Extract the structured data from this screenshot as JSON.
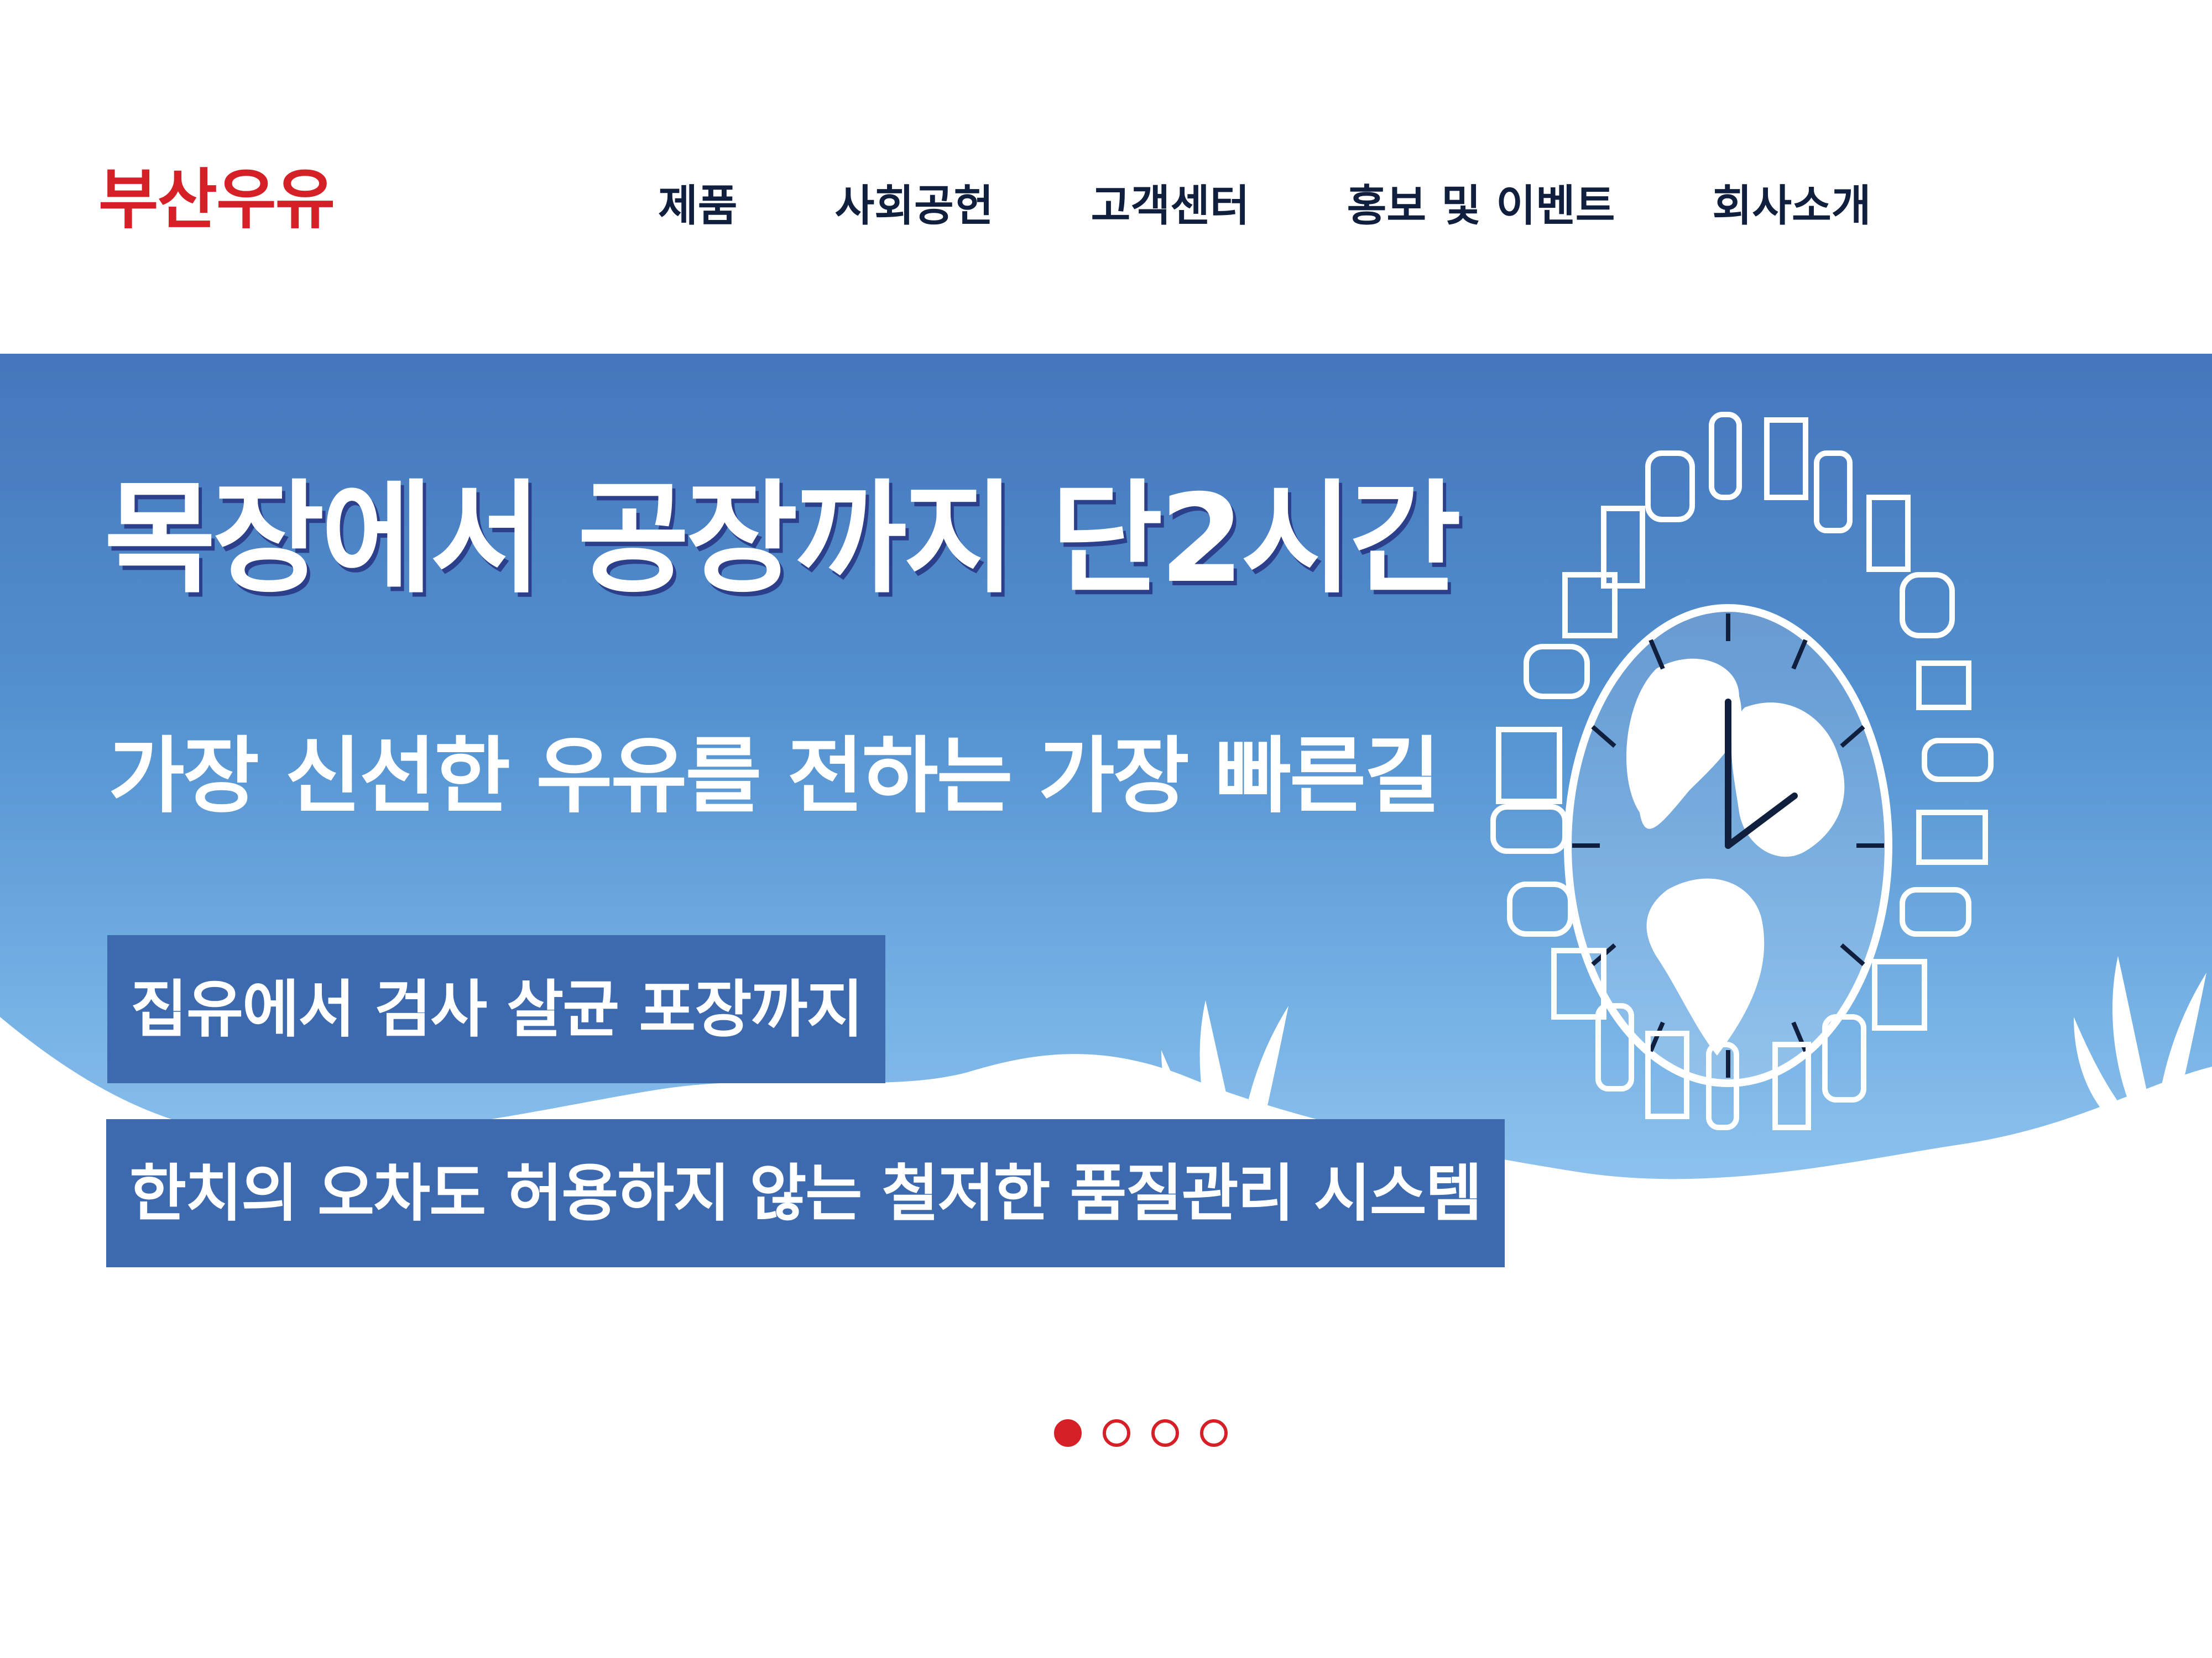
{
  "colors": {
    "brand": "#d42026",
    "nav_text": "#0f1f3d",
    "hero_top": "#4576bb",
    "hero_bottom": "#a4d2f6",
    "tag_box": "#3d6aae"
  },
  "header": {
    "logo": "부산우유",
    "nav": [
      {
        "label": "제품"
      },
      {
        "label": "사회공헌"
      },
      {
        "label": "고객센터"
      },
      {
        "label": "홍보 및 이벤트"
      },
      {
        "label": "회사소개"
      }
    ]
  },
  "hero": {
    "headline": "목장에서 공장까지 단2시간",
    "subline": "가장 신선한 우유를 전하는 가장 빠른길",
    "tags": [
      "집유에서 검사 살균 포장까지",
      "한치의 오차도 허용하지 않는 철저한 품질관리 시스템"
    ],
    "illustration": "clock-globe-milk-products-icon"
  },
  "carousel": {
    "slide_count": 4,
    "active_index": 0
  }
}
